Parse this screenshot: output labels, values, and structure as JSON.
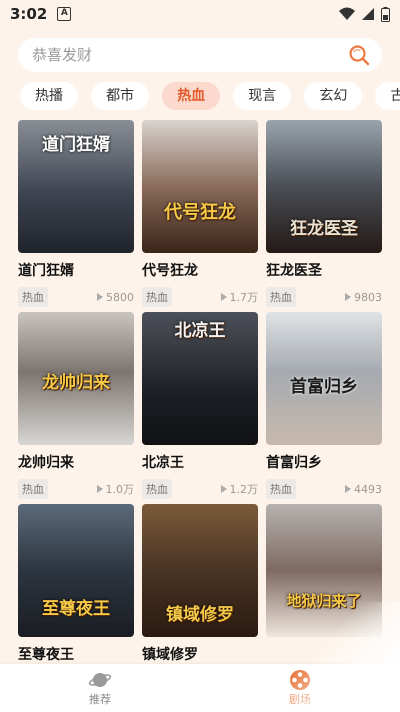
{
  "status": {
    "time": "3:02",
    "notif_letter": "A"
  },
  "search": {
    "placeholder": "恭喜发财"
  },
  "tabs": [
    {
      "label": "热播"
    },
    {
      "label": "都市"
    },
    {
      "label": "热血"
    },
    {
      "label": "现言"
    },
    {
      "label": "玄幻"
    },
    {
      "label": "古"
    }
  ],
  "cards": [
    {
      "title": "道门狂婿",
      "genre": "热血",
      "views": "5800",
      "poster_text": "道门狂婿"
    },
    {
      "title": "代号狂龙",
      "genre": "热血",
      "views": "1.7万",
      "poster_text": "代号狂龙"
    },
    {
      "title": "狂龙医圣",
      "genre": "热血",
      "views": "9803",
      "poster_text": "狂龙医圣"
    },
    {
      "title": "龙帅归来",
      "genre": "热血",
      "views": "1.0万",
      "poster_text": "龙帅归来"
    },
    {
      "title": "北凉王",
      "genre": "热血",
      "views": "1.2万",
      "poster_text": "北凉王"
    },
    {
      "title": "首富归乡",
      "genre": "热血",
      "views": "4493",
      "poster_text": "首富归乡"
    },
    {
      "title": "至尊夜王",
      "genre": "",
      "views": "",
      "poster_text": "至尊夜王"
    },
    {
      "title": "镇域修罗",
      "genre": "",
      "views": "",
      "poster_text": "镇域修罗"
    },
    {
      "title": "",
      "genre": "",
      "views": "",
      "poster_text": "地狱归来了"
    }
  ],
  "nav": {
    "recommend_label": "推荐",
    "theater_label": "剧场"
  },
  "colors": {
    "accent": "#e8753a",
    "tab_active_bg": "#fbd9cc",
    "page_bg": "#fdf3ea"
  }
}
